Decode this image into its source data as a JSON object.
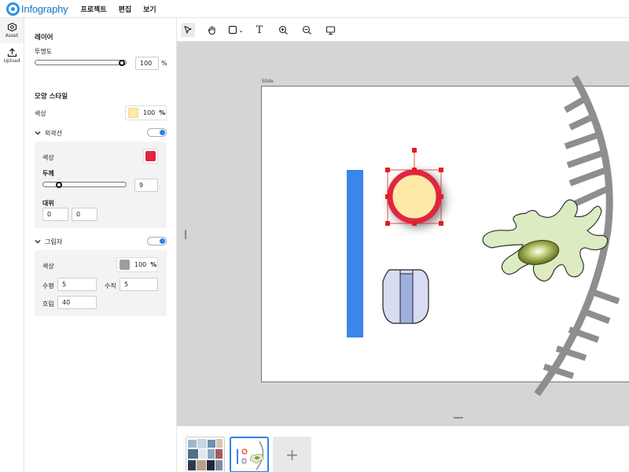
{
  "app": {
    "logo_text": "Infography"
  },
  "menu": {
    "items": [
      "프로젝트",
      "편집",
      "보기"
    ]
  },
  "rail": {
    "items": [
      {
        "label": "Asset",
        "icon": "asset-icon"
      },
      {
        "label": "Upload",
        "icon": "upload-icon"
      }
    ]
  },
  "panel": {
    "layer_title": "레이어",
    "opacity_label": "투명도",
    "opacity_value": "100",
    "opacity_unit": "%",
    "shape_style_title": "모양 스타일",
    "fill_label": "색상",
    "fill_color": "#fde9a8",
    "fill_opacity": "100",
    "fill_opacity_unit": "%",
    "outline": {
      "title": "외곽선",
      "enabled": true,
      "color_label": "색상",
      "color": "#e0253f",
      "thickness_label": "두께",
      "thickness_value": "9",
      "contrast_label": "대위",
      "contrast_a": "0",
      "contrast_b": "0"
    },
    "shadow": {
      "title": "그림자",
      "enabled": true,
      "color_label": "색상",
      "color": "#9e9e9e",
      "opacity": "100",
      "opacity_unit": "%",
      "horizontal_label": "수평",
      "horizontal_value": "5",
      "vertical_label": "수직",
      "vertical_value": "5",
      "blur_label": "흐림",
      "blur_value": "40"
    }
  },
  "toolbar": {
    "tools": [
      "select-arrow-icon",
      "hand-icon",
      "rectangle-icon",
      "text-icon",
      "zoom-in-icon",
      "zoom-out-icon",
      "present-icon"
    ],
    "shape_dropdown": "⌄",
    "text_tool_glyph": "T"
  },
  "canvas": {
    "slide_label": "Slide",
    "background": "#d5d5d5",
    "shapes": {
      "bar_color": "#3b86ea",
      "circle_fill": "#fde9a8",
      "circle_stroke": "#e0253f",
      "selection_color": "#e02020",
      "cell_color": "#dcebc2",
      "nucleus_color": "#7d8f30",
      "dna_color": "#8e8e8e",
      "capsule_fill": "#d7dcf3",
      "capsule_inner": "#9fb0df"
    }
  },
  "thumbnails": {
    "count": 2,
    "active_index": 1,
    "add_label": "+"
  }
}
